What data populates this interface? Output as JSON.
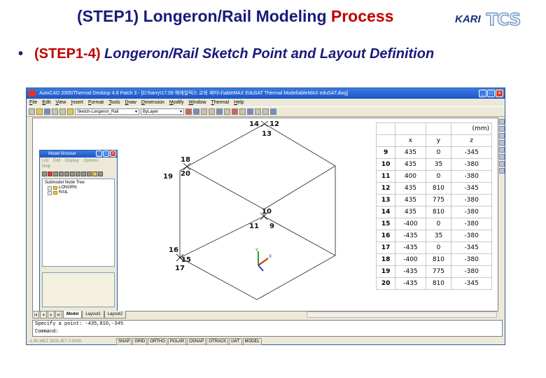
{
  "slide": {
    "title_prefix": "(STEP1) Longeron/Rail Modeling ",
    "title_highlight": "Process",
    "bullet": "•",
    "step": "(STEP1-4)",
    "description": "Longeron/Rail Sketch Point and Layout Definition",
    "logo_kari": "KARI",
    "logo_tcs": "TCS"
  },
  "window": {
    "title": "AutoCAD 2005/Thermal Desktop 4.8 Patch 3 - [D:\\harry\\17.09 해에얼럭스 교육 세미나\\ableMAX EduSAT Thermal Model\\ableMAX eduSAT.dwg]",
    "minimize": "_",
    "maximize": "□",
    "close": "×"
  },
  "menu": [
    "File",
    "Edit",
    "View",
    "Insert",
    "Format",
    "Tools",
    "Draw",
    "Dimension",
    "Modify",
    "Window",
    "Thermal",
    "Help"
  ],
  "toolbar": {
    "layer_combo": "Sketch-Longeron_Rail",
    "linetype_combo": "ByLayer"
  },
  "model_browser": {
    "title": "Model Browser",
    "menu": [
      "List",
      "Edit",
      "Display",
      "Options",
      "Help"
    ],
    "tree_root": "Submodel Node Tree",
    "tree_items": [
      "LONGRN",
      "RAIL"
    ]
  },
  "points": [
    {
      "id": "9",
      "x": "435",
      "y": "0",
      "z": "-345"
    },
    {
      "id": "10",
      "x": "435",
      "y": "35",
      "z": "-380"
    },
    {
      "id": "11",
      "x": "400",
      "y": "0",
      "z": "-380"
    },
    {
      "id": "12",
      "x": "435",
      "y": "810",
      "z": "-345"
    },
    {
      "id": "13",
      "x": "435",
      "y": "775",
      "z": "-380"
    },
    {
      "id": "14",
      "x": "435",
      "y": "810",
      "z": "-380"
    },
    {
      "id": "15",
      "x": "-400",
      "y": "0",
      "z": "-380"
    },
    {
      "id": "16",
      "x": "-435",
      "y": "35",
      "z": "-380"
    },
    {
      "id": "17",
      "x": "-435",
      "y": "0",
      "z": "-345"
    },
    {
      "id": "18",
      "x": "-400",
      "y": "810",
      "z": "-380"
    },
    {
      "id": "19",
      "x": "-435",
      "y": "775",
      "z": "-380"
    },
    {
      "id": "20",
      "x": "-435",
      "y": "810",
      "z": "-345"
    }
  ],
  "table": {
    "unit": "(mm)",
    "col_x": "x",
    "col_y": "y",
    "col_z": "z"
  },
  "tabs": [
    "Model",
    "Layout1",
    "Layout2"
  ],
  "command": {
    "line1": "Specify a point: -435,810,-345",
    "line2": "Command:"
  },
  "status": {
    "coords": "-1.85.MEZ  2505.3E7  0.0000",
    "toggles": [
      "SNAP",
      "GRID",
      "ORTHO",
      "POLAR",
      "OSNAP",
      "OTRACK",
      "LWT",
      "MODEL"
    ]
  },
  "colors": {
    "title": "#1a1a7a",
    "highlight": "#c00000",
    "titlebar": "#1c54c6"
  }
}
